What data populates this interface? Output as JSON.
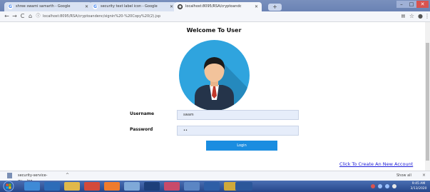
{
  "browser": {
    "tabs": [
      {
        "title": "shree swami samarth - Google",
        "active": false
      },
      {
        "title": "security text label icon - Google",
        "active": false
      },
      {
        "title": "localhost:8095/RSA/cryptoandc",
        "active": true
      }
    ],
    "url": "localhost:8095/RSA/cryptoandenc/signin%20-%20Copy%20(2).jsp",
    "nav": {
      "back": "←",
      "forward": "→",
      "reload": "C",
      "home": "⌂",
      "info": "ⓘ"
    }
  },
  "page": {
    "title": "Welcome To User",
    "form": {
      "username_label": "Username",
      "username_value": "swam",
      "password_label": "Password",
      "password_value": "••",
      "login_label": "Login"
    },
    "create_link": "Click To Create An New Account"
  },
  "downloads": {
    "file_name": "security-service-qu....jpg",
    "chevron": "^",
    "show_all": "Show all",
    "close": "×"
  },
  "taskbar": {
    "clock_time": "9:45 AM",
    "clock_date": "3/13/2020"
  },
  "colors": {
    "accent_button": "#1a8de0",
    "avatar_bg": "#2fa4de",
    "link": "#1a1ad8"
  }
}
